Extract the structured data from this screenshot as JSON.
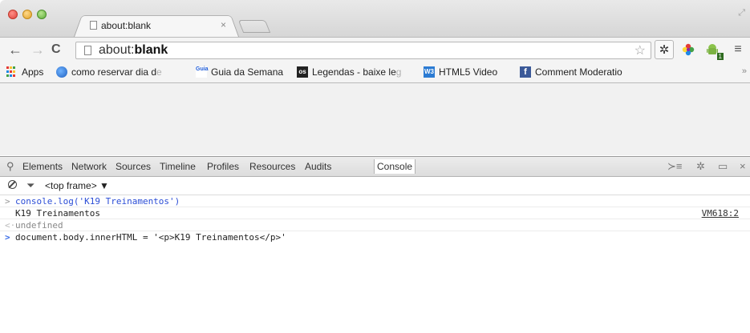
{
  "tab": {
    "title": "about:blank",
    "close": "×"
  },
  "toolbar": {
    "back": "←",
    "forward": "→",
    "reload": "C",
    "url_prefix": "about:",
    "url_bold": "blank",
    "star": "☆",
    "gear": "✲",
    "menu": "≡",
    "android_badge": "1"
  },
  "bookmarks": [
    {
      "label": "Apps",
      "icon": "apps-grid-icon"
    },
    {
      "label": "como reservar dia d",
      "fade": "e",
      "icon": "globe-icon"
    },
    {
      "label": "Guia da Semana",
      "icon": "guia-icon"
    },
    {
      "label": "Legendas - baixe le",
      "fade": "g",
      "icon": "os-icon"
    },
    {
      "label": "HTML5 Video",
      "icon": "w3-icon"
    },
    {
      "label": "Comment Moderatio",
      "fade": "",
      "icon": "facebook-icon"
    }
  ],
  "bookmarks_overflow": "»",
  "devtools": {
    "tabs": [
      "Elements",
      "Network",
      "Sources",
      "Timeline",
      "Profiles",
      "Resources",
      "Audits",
      "Console"
    ],
    "active_tab": "Console",
    "frame": "<top frame> ▼",
    "right_icons": {
      "drawer": "≻≡",
      "settings": "✲",
      "dock": "▭",
      "close": "×"
    }
  },
  "console": {
    "lines": [
      {
        "type": "cmd",
        "prompt": ">",
        "text": "console.log('K19 Treinamentos')"
      },
      {
        "type": "log",
        "prompt": "",
        "text": "K19 Treinamentos",
        "source": "VM618:2"
      },
      {
        "type": "result",
        "prompt": "<·",
        "text": "undefined"
      },
      {
        "type": "input",
        "prompt": ">",
        "text": "document.body.innerHTML = '<p>K19 Treinamentos</p>'"
      }
    ]
  }
}
